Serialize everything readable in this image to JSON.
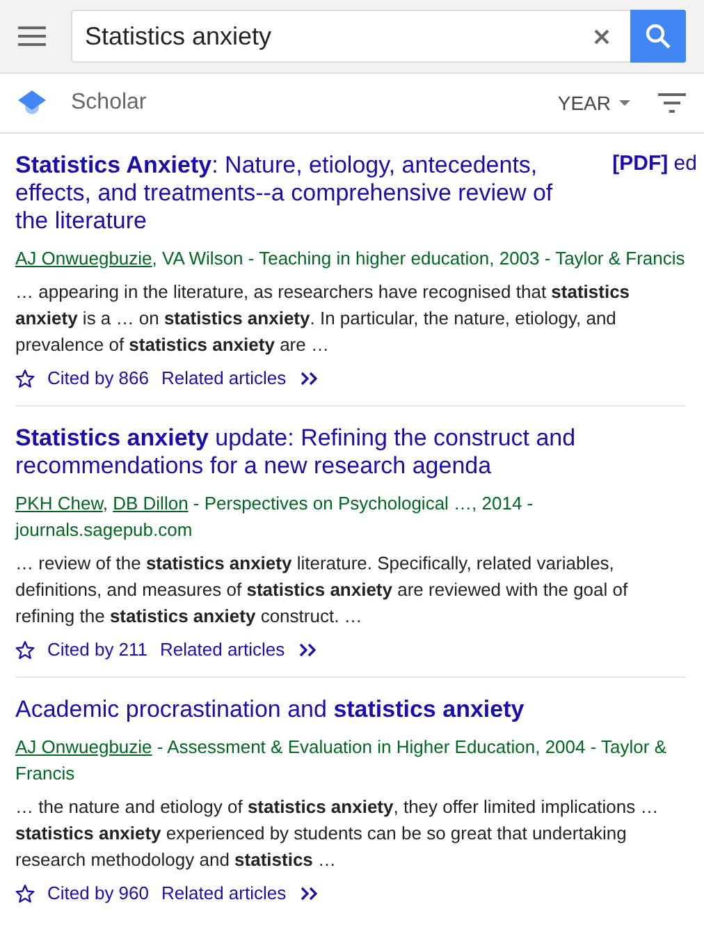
{
  "search": {
    "value": "Statistics anxiety"
  },
  "toolbar": {
    "brand": "Scholar",
    "year_menu": "YEAR"
  },
  "results": [
    {
      "title": "**Statistics Anxiety**: Nature, etiology, antecedents, effects, and treatments--a comprehensive review of the literature",
      "pdf": {
        "tag": "[PDF]",
        "source": "ed"
      },
      "byline": [
        {
          "text": "AJ Onwuegbuzie",
          "link": true
        },
        {
          "text": ", VA Wilson - Teaching in higher education, 2003 - Taylor & Francis",
          "link": false
        }
      ],
      "snippet": "… appearing in the literature, as researchers have recognised that **statistics anxiety** is a … on **statistics anxiety**. In particular, the nature, etiology, and prevalence of **statistics anxiety** are …",
      "cited": "Cited by 866",
      "related": "Related articles",
      "starred": false
    },
    {
      "title": "**Statistics anxiety** update: Refining the construct and recommendations for a new research agenda",
      "byline": [
        {
          "text": "PKH Chew",
          "link": true
        },
        {
          "text": ", ",
          "link": false
        },
        {
          "text": "DB Dillon",
          "link": true
        },
        {
          "text": " - Perspectives on Psychological …, 2014 - journals.sagepub.com",
          "link": false
        }
      ],
      "snippet": "… review of the **statistics anxiety** literature. Specifically, related variables, definitions, and measures of **statistics anxiety** are reviewed with the goal of refining the **statistics anxiety** construct. …",
      "cited": "Cited by 211",
      "related": "Related articles",
      "starred": false
    },
    {
      "title": "Academic procrastination and **statistics anxiety**",
      "byline": [
        {
          "text": "AJ Onwuegbuzie",
          "link": true
        },
        {
          "text": " - Assessment & Evaluation in Higher Education, 2004 - Taylor & Francis",
          "link": false
        }
      ],
      "snippet": "… the nature and etiology of **statistics anxiety**, they offer limited implications … **statistics anxiety** experienced by students can be so great that undertaking research methodology and **statistics** …",
      "cited": "Cited by 960",
      "related": "Related articles",
      "starred": false
    }
  ]
}
